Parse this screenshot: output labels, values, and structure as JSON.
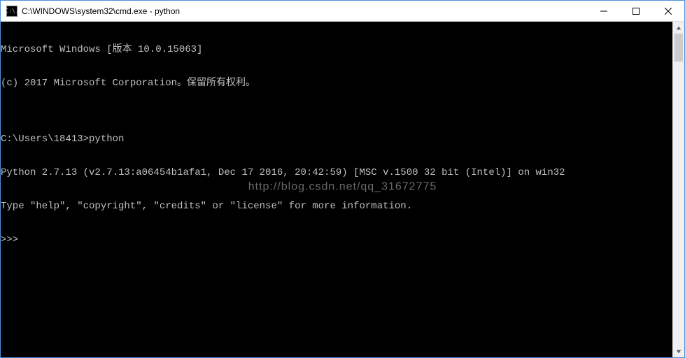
{
  "window": {
    "title": "C:\\WINDOWS\\system32\\cmd.exe - python",
    "icon_label": "C:\\."
  },
  "terminal": {
    "lines": [
      "Microsoft Windows [版本 10.0.15063]",
      "(c) 2017 Microsoft Corporation。保留所有权利。",
      "",
      "C:\\Users\\18413>python",
      "Python 2.7.13 (v2.7.13:a06454b1afa1, Dec 17 2016, 20:42:59) [MSC v.1500 32 bit (Intel)] on win32",
      "Type \"help\", \"copyright\", \"credits\" or \"license\" for more information.",
      ">>>"
    ]
  },
  "watermark": "http://blog.csdn.net/qq_31672775"
}
